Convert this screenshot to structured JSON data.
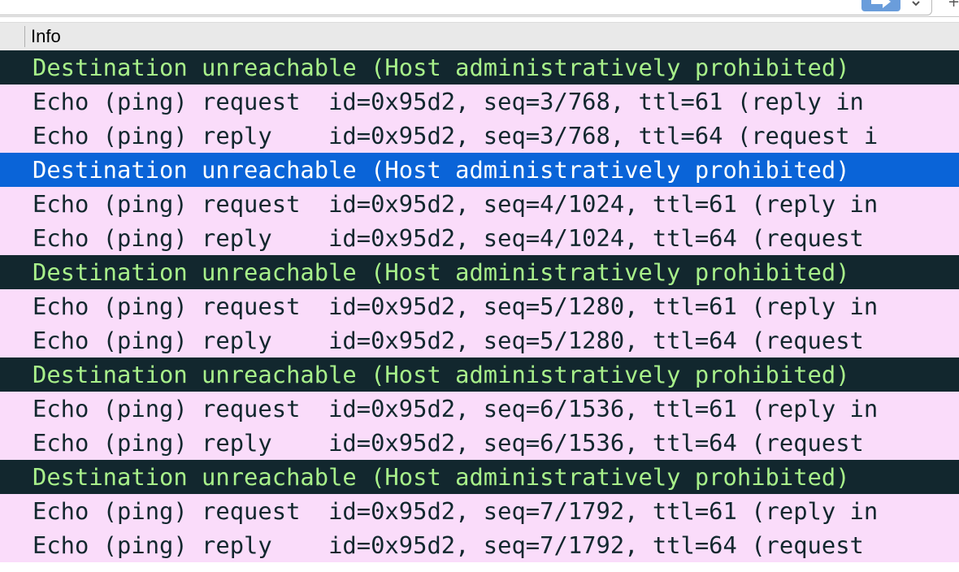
{
  "header": {
    "column_title": "Info"
  },
  "rows": [
    {
      "type": "unreach",
      "text": "Destination unreachable (Host administratively prohibited)"
    },
    {
      "type": "echo",
      "text": "Echo (ping) request  id=0x95d2, seq=3/768, ttl=61 (reply in"
    },
    {
      "type": "echo",
      "text": "Echo (ping) reply    id=0x95d2, seq=3/768, ttl=64 (request i"
    },
    {
      "type": "selected",
      "text": "Destination unreachable (Host administratively prohibited)"
    },
    {
      "type": "echo",
      "text": "Echo (ping) request  id=0x95d2, seq=4/1024, ttl=61 (reply in"
    },
    {
      "type": "echo",
      "text": "Echo (ping) reply    id=0x95d2, seq=4/1024, ttl=64 (request"
    },
    {
      "type": "unreach",
      "text": "Destination unreachable (Host administratively prohibited)"
    },
    {
      "type": "echo",
      "text": "Echo (ping) request  id=0x95d2, seq=5/1280, ttl=61 (reply in"
    },
    {
      "type": "echo",
      "text": "Echo (ping) reply    id=0x95d2, seq=5/1280, ttl=64 (request"
    },
    {
      "type": "unreach",
      "text": "Destination unreachable (Host administratively prohibited)"
    },
    {
      "type": "echo",
      "text": "Echo (ping) request  id=0x95d2, seq=6/1536, ttl=61 (reply in"
    },
    {
      "type": "echo",
      "text": "Echo (ping) reply    id=0x95d2, seq=6/1536, ttl=64 (request"
    },
    {
      "type": "unreach",
      "text": "Destination unreachable (Host administratively prohibited)"
    },
    {
      "type": "echo",
      "text": "Echo (ping) request  id=0x95d2, seq=7/1792, ttl=61 (reply in"
    },
    {
      "type": "echo",
      "text": "Echo (ping) reply    id=0x95d2, seq=7/1792, ttl=64 (request"
    }
  ],
  "colors": {
    "unreach_bg": "#12272e",
    "unreach_fg": "#a8f08a",
    "echo_bg": "#fadcfa",
    "echo_fg": "#12272e",
    "selected_bg": "#0a64d8",
    "selected_fg": "#ffffff"
  },
  "icons": {
    "apply": "arrow-right-icon",
    "dropdown": "chevron-down-icon",
    "add": "plus-icon"
  }
}
